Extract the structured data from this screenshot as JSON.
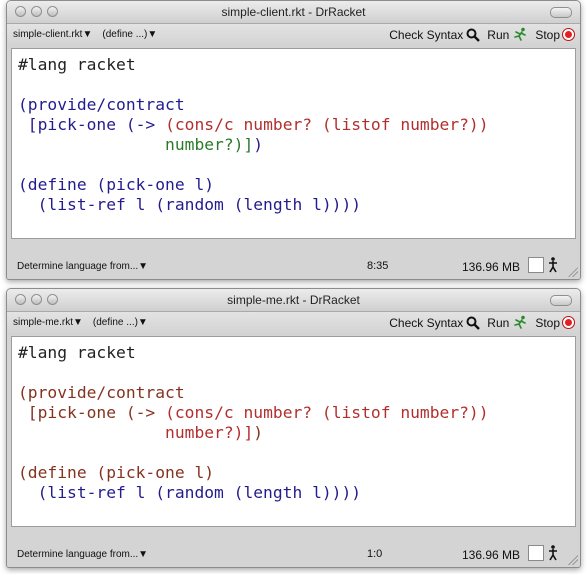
{
  "windows": [
    {
      "title": "simple-client.rkt - DrRacket",
      "file_menu": "simple-client.rkt▼",
      "define_menu": "(define ...)▼",
      "check_syntax": "Check Syntax",
      "run": "Run",
      "stop": "Stop",
      "code": {
        "line1": "#lang racket",
        "provide_head": "(provide/contract",
        "contract_a": " [pick-one ",
        "arrow": "(->",
        "cons_c": "(cons/c number? (listof number?))",
        "contract_b": "number?",
        "closers_b": ")]",
        "closer_final": ")",
        "define_head": "(define (pick-one l)",
        "body": "  (list-ref l (random (length l))))"
      },
      "status_language": "Determine language from...▼",
      "position": "8:35",
      "memory": "136.96 MB"
    },
    {
      "title": "simple-me.rkt - DrRacket",
      "file_menu": "simple-me.rkt▼",
      "define_menu": "(define ...)▼",
      "check_syntax": "Check Syntax",
      "run": "Run",
      "stop": "Stop",
      "code": {
        "line1": "#lang racket",
        "provide_head": "(provide/contract",
        "contract_a": " [pick-one ",
        "arrow": "(->",
        "cons_c": "(cons/c number? (listof number?))",
        "contract_b": "number?",
        "closers_b": ")]",
        "closer_final": ")",
        "define_head": "(define (pick-one l)",
        "body": "  (list-ref l (random (length l))))"
      },
      "status_language": "Determine language from...▼",
      "position": "1:0",
      "memory": "136.96 MB"
    }
  ],
  "colors": {
    "paren": "#84331f",
    "identifier": "#231c8f",
    "library": "#b22f2f",
    "contract_green": "#2a7a2a",
    "stop_red": "#e41f1f"
  },
  "icons": [
    "magnifier-icon",
    "runner-icon",
    "stop-circle-icon",
    "walker-icon",
    "grow-box-icon"
  ]
}
